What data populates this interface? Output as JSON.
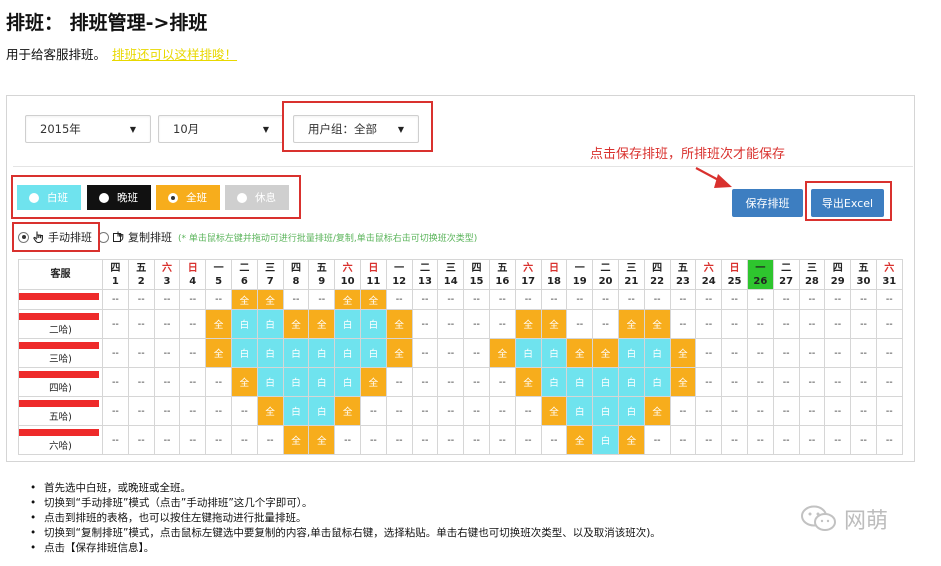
{
  "title": "排班： 排班管理->排班",
  "subtitle": "用于给客服排班。",
  "subtitle_link": "排班还可以这样排唆！",
  "filters": {
    "year": "2015年",
    "month": "10月",
    "group": "用户组：全部"
  },
  "shifts": [
    {
      "label": "白班",
      "color": "#6fe3ee",
      "text_color": "#ffffff",
      "dot_color": "#ffffff"
    },
    {
      "label": "晚班",
      "color": "#111111",
      "text_color": "#ffffff",
      "dot_color": "#ffffff"
    },
    {
      "label": "全班",
      "color": "#f7ad1c",
      "text_color": "#ffffff",
      "dot_color": "#ffffff",
      "selected": true
    },
    {
      "label": "休息",
      "color": "#cfcfcf",
      "text_color": "#ffffff",
      "dot_color": "#ffffff"
    }
  ],
  "annotation": "点击保存排班，所排班次才能保存",
  "buttons": {
    "save": "保存排班",
    "export": "导出Excel"
  },
  "modes": {
    "manual": "手动排班",
    "copy": "复制排班",
    "hint": "(* 单击鼠标左键并拖动可进行批量排班/复制,单击鼠标右击可切换班次类型)"
  },
  "grid": {
    "header": "客服",
    "today": 26,
    "days": [
      {
        "w": "四",
        "d": "1"
      },
      {
        "w": "五",
        "d": "2"
      },
      {
        "w": "六",
        "d": "3",
        "red": true
      },
      {
        "w": "日",
        "d": "4",
        "red": true
      },
      {
        "w": "一",
        "d": "5"
      },
      {
        "w": "二",
        "d": "6"
      },
      {
        "w": "三",
        "d": "7"
      },
      {
        "w": "四",
        "d": "8"
      },
      {
        "w": "五",
        "d": "9"
      },
      {
        "w": "六",
        "d": "10",
        "red": true
      },
      {
        "w": "日",
        "d": "11",
        "red": true
      },
      {
        "w": "一",
        "d": "12"
      },
      {
        "w": "二",
        "d": "13"
      },
      {
        "w": "三",
        "d": "14"
      },
      {
        "w": "四",
        "d": "15"
      },
      {
        "w": "五",
        "d": "16"
      },
      {
        "w": "六",
        "d": "17",
        "red": true
      },
      {
        "w": "日",
        "d": "18",
        "red": true
      },
      {
        "w": "一",
        "d": "19"
      },
      {
        "w": "二",
        "d": "20"
      },
      {
        "w": "三",
        "d": "21"
      },
      {
        "w": "四",
        "d": "22"
      },
      {
        "w": "五",
        "d": "23"
      },
      {
        "w": "六",
        "d": "24",
        "red": true
      },
      {
        "w": "日",
        "d": "25",
        "red": true
      },
      {
        "w": "一",
        "d": "26"
      },
      {
        "w": "二",
        "d": "27"
      },
      {
        "w": "三",
        "d": "28"
      },
      {
        "w": "四",
        "d": "29"
      },
      {
        "w": "五",
        "d": "30"
      },
      {
        "w": "六",
        "d": "31",
        "red": true
      }
    ],
    "rows": [
      {
        "name": "",
        "cells": [
          "-",
          "-",
          "-",
          "-",
          "-",
          "Q",
          "Q",
          "-",
          "-",
          "Q",
          "Q",
          "-",
          "-",
          "-",
          "-",
          "-",
          "-",
          "-",
          "-",
          "-",
          "-",
          "-",
          "-",
          "-",
          "-",
          "-",
          "-",
          "-",
          "-",
          "-",
          "-"
        ]
      },
      {
        "name": "二哈)",
        "cells": [
          "-",
          "-",
          "-",
          "-",
          "Q",
          "B",
          "B",
          "Q",
          "Q",
          "B",
          "B",
          "Q",
          "-",
          "-",
          "-",
          "-",
          "Q",
          "Q",
          "-",
          "-",
          "Q",
          "Q",
          "-",
          "-",
          "-",
          "-",
          "-",
          "-",
          "-",
          "-",
          "-"
        ]
      },
      {
        "name": "三哈)",
        "cells": [
          "-",
          "-",
          "-",
          "-",
          "Q",
          "B",
          "B",
          "B",
          "B",
          "B",
          "B",
          "Q",
          "-",
          "-",
          "-",
          "Q",
          "B",
          "B",
          "Q",
          "Q",
          "B",
          "B",
          "Q",
          "-",
          "-",
          "-",
          "-",
          "-",
          "-",
          "-",
          "-"
        ]
      },
      {
        "name": "四哈)",
        "cells": [
          "-",
          "-",
          "-",
          "-",
          "-",
          "Q",
          "B",
          "B",
          "B",
          "B",
          "Q",
          "-",
          "-",
          "-",
          "-",
          "-",
          "Q",
          "B",
          "B",
          "B",
          "B",
          "B",
          "Q",
          "-",
          "-",
          "-",
          "-",
          "-",
          "-",
          "-",
          "-"
        ]
      },
      {
        "name": "五哈)",
        "cells": [
          "-",
          "-",
          "-",
          "-",
          "-",
          "-",
          "Q",
          "B",
          "B",
          "Q",
          "-",
          "-",
          "-",
          "-",
          "-",
          "-",
          "-",
          "Q",
          "B",
          "B",
          "B",
          "Q",
          "-",
          "-",
          "-",
          "-",
          "-",
          "-",
          "-",
          "-",
          "-"
        ]
      },
      {
        "name": "六哈)",
        "cells": [
          "-",
          "-",
          "-",
          "-",
          "-",
          "-",
          "-",
          "Q",
          "Q",
          "-",
          "-",
          "-",
          "-",
          "-",
          "-",
          "-",
          "-",
          "-",
          "Q",
          "B",
          "Q",
          "-",
          "-",
          "-",
          "-",
          "-",
          "-",
          "-",
          "-",
          "-",
          "-"
        ]
      }
    ],
    "labels": {
      "Q": "全",
      "B": "白",
      "-": "--"
    }
  },
  "notes": [
    "首先选中白班，或晚班或全班。",
    "切换到“手动排班”模式（点击”手动排班”这几个字即可）。",
    "点击到排班的表格，也可以按住左键拖动进行批量排班。",
    "切换到“复制排班”模式，点击鼠标左键选中要复制的内容,单击鼠标右键，选择粘贴。单击右键也可切换班次类型、以及取消该班次)。",
    "点击【保存排班信息】。"
  ],
  "watermark": "网萌",
  "colors": {
    "accent_red": "#d9312e",
    "blue_button": "#3d7ec1",
    "today_green": "#2ec52e",
    "full_shift": "#f7ad1c",
    "day_shift": "#6fe3ee"
  }
}
